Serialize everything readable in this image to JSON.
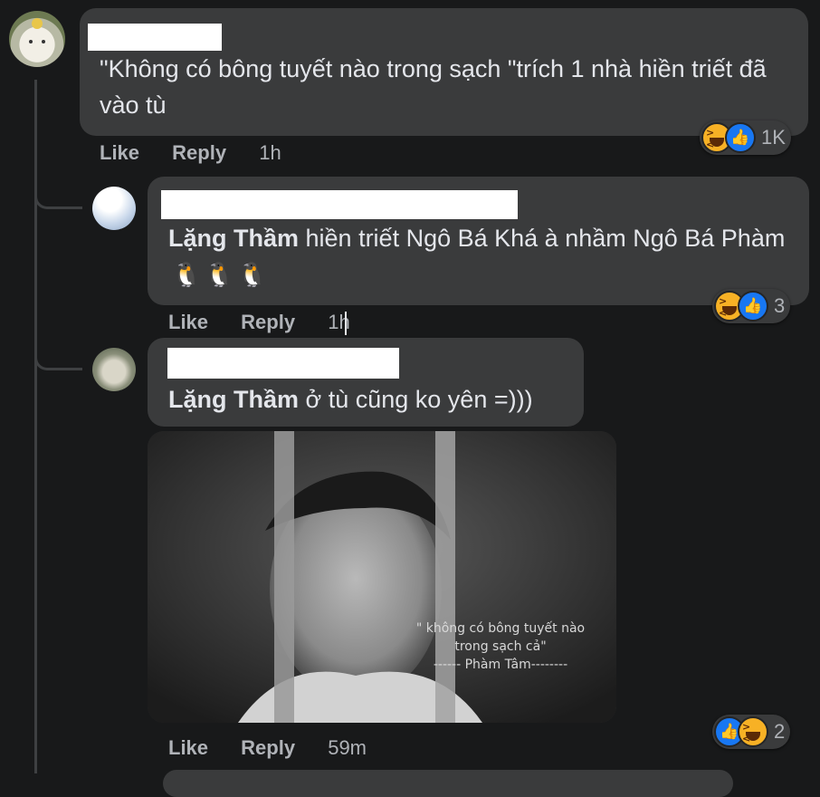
{
  "comments": [
    {
      "text": "\"Không có bông tuyết nào trong sạch \"trích 1 nhà hiền triết đã vào tù",
      "actions": {
        "like": "Like",
        "reply": "Reply",
        "time": "1h"
      },
      "reaction_count": "1K"
    },
    {
      "mention": "Lặng Thầm",
      "text": " hiền triết Ngô Bá Khá à nhầm Ngô Bá Phàm ",
      "emoji": [
        "🐧",
        "🐧",
        "🐧"
      ],
      "actions": {
        "like": "Like",
        "reply": "Reply",
        "time": "1h"
      },
      "reaction_count": "3"
    },
    {
      "mention": "Lặng Thầm",
      "text": " ở tù cũng ko yên =)))",
      "image_caption": [
        "\" không có bông tuyết nào",
        "trong sạch cả\"",
        "------ Phàm Tâm--------"
      ],
      "actions": {
        "like": "Like",
        "reply": "Reply",
        "time": "59m"
      },
      "reaction_count": "2"
    }
  ],
  "colors": {
    "background": "#18191a",
    "bubble": "#3a3b3c",
    "like_blue": "#1877f2",
    "haha_yellow": "#f7b125"
  }
}
